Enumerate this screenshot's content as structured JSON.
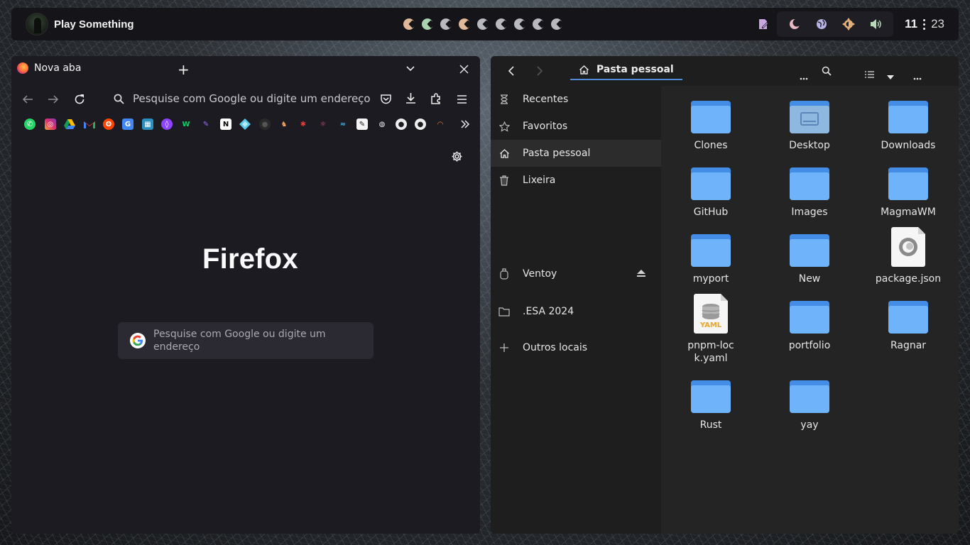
{
  "topbar": {
    "title": "Play Something",
    "workspace_colors": [
      "#e0b99a",
      "#a8d4b0",
      "#b9b9c0",
      "#e0b99a",
      "#b9b9c0",
      "#b9b9c0",
      "#b9b9c0",
      "#b9b9c0",
      "#b9b9c0"
    ],
    "clock": {
      "hour": "11",
      "minute": "23"
    },
    "icons": [
      "note-pencil-icon",
      "moon-icon",
      "globe-icon",
      "brightness-icon",
      "volume-icon"
    ]
  },
  "firefox": {
    "tab_title": "Nova aba",
    "url_placeholder": "Pesquise com Google ou digite um endereço",
    "brand": "Firefox",
    "search_placeholder": "Pesquise com Google ou digite um endereço",
    "bookmarks": [
      "whatsapp",
      "instagram",
      "google-drive",
      "gmail",
      "reddit",
      "google-translate",
      "calculator",
      "proton",
      "webtoon",
      "pen",
      "notion",
      "sourcegraph",
      "github-dark",
      "brave",
      "insect",
      "react",
      "tailwind",
      "notes",
      "globe",
      "github",
      "github-2",
      "mozilla"
    ]
  },
  "files": {
    "location": "Pasta pessoal",
    "sidebar": [
      {
        "label": "Recentes",
        "icon": "hourglass-icon"
      },
      {
        "label": "Favoritos",
        "icon": "star-icon"
      },
      {
        "label": "Pasta pessoal",
        "icon": "home-icon"
      },
      {
        "label": "Lixeira",
        "icon": "trash-icon"
      },
      {
        "label": "Ventoy",
        "icon": "drive-icon"
      },
      {
        "label": ".ESA 2024",
        "icon": "folder-outline-icon"
      },
      {
        "label": "Outros locais",
        "icon": "plus-icon"
      }
    ],
    "items": [
      {
        "name": "Clones",
        "kind": "folder"
      },
      {
        "name": "Desktop",
        "kind": "folder-desktop"
      },
      {
        "name": "Downloads",
        "kind": "folder"
      },
      {
        "name": "GitHub",
        "kind": "folder"
      },
      {
        "name": "Images",
        "kind": "folder"
      },
      {
        "name": "MagmaWM",
        "kind": "folder"
      },
      {
        "name": "myport",
        "kind": "folder"
      },
      {
        "name": "New",
        "kind": "folder"
      },
      {
        "name": "package.json",
        "kind": "json"
      },
      {
        "name": "pnpm-lock.yaml",
        "kind": "yaml"
      },
      {
        "name": "portfolio",
        "kind": "folder"
      },
      {
        "name": "Ragnar",
        "kind": "folder"
      },
      {
        "name": "Rust",
        "kind": "folder"
      },
      {
        "name": "yay",
        "kind": "folder"
      }
    ],
    "yaml_badge": "YAML"
  }
}
